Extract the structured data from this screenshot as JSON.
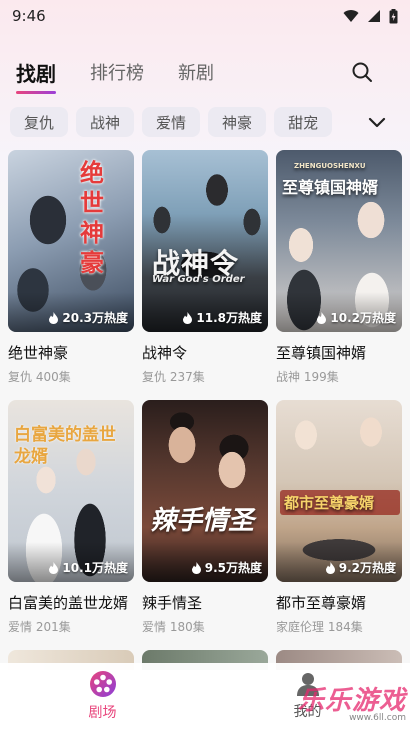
{
  "status_bar": {
    "time": "9:46"
  },
  "top_tabs": [
    {
      "label": "找剧",
      "active": true
    },
    {
      "label": "排行榜",
      "active": false
    },
    {
      "label": "新剧",
      "active": false
    }
  ],
  "search": {
    "icon": "search-icon"
  },
  "categories": [
    "复仇",
    "战神",
    "爱情",
    "神豪",
    "甜宠"
  ],
  "more_icon": "chevron-down-icon",
  "dramas": [
    {
      "title": "绝世神豪",
      "genre": "复仇",
      "episodes": "400集",
      "heat": "20.3万热度",
      "poster_text": "绝世神豪",
      "poster_colors": [
        "#3b4a5e",
        "#c9d3df",
        "#7a8ea6"
      ]
    },
    {
      "title": "战神令",
      "genre": "复仇",
      "episodes": "237集",
      "heat": "11.8万热度",
      "poster_text": "战神令",
      "poster_sub": "War God's Order",
      "poster_colors": [
        "#7fa0b8",
        "#3a3f45",
        "#b07a5c"
      ]
    },
    {
      "title": "至尊镇国神婿",
      "genre": "战神",
      "episodes": "199集",
      "heat": "10.2万热度",
      "poster_text": "至尊镇国神婿",
      "poster_sub": "ZHENGUOSHENXU",
      "poster_colors": [
        "#4d5a6c",
        "#9aa6b4",
        "#d9d4d0"
      ]
    },
    {
      "title": "白富美的盖世龙婿",
      "genre": "爱情",
      "episodes": "201集",
      "heat": "10.1万热度",
      "poster_text": "白富美的盖世龙婿",
      "poster_colors": [
        "#e9e4de",
        "#bfc6cf",
        "#2c2f35"
      ]
    },
    {
      "title": "辣手情圣",
      "genre": "爱情",
      "episodes": "180集",
      "heat": "9.5万热度",
      "poster_text": "辣手情圣",
      "poster_colors": [
        "#2a1e1c",
        "#7c4a3a",
        "#d9b39a"
      ]
    },
    {
      "title": "都市至尊豪婿",
      "genre": "家庭伦理",
      "episodes": "184集",
      "heat": "9.2万热度",
      "poster_text": "都市至尊豪婿",
      "poster_colors": [
        "#e7ddd3",
        "#c0a58a",
        "#3f3a3a"
      ]
    }
  ],
  "bottom_nav": [
    {
      "label": "剧场",
      "icon": "film-reel-icon",
      "active": true
    },
    {
      "label": "我的",
      "icon": "profile-icon",
      "active": false
    }
  ],
  "watermark": {
    "main": "乐乐游戏",
    "sub": "www.6ll.com"
  },
  "accent_color": "#e8457c"
}
